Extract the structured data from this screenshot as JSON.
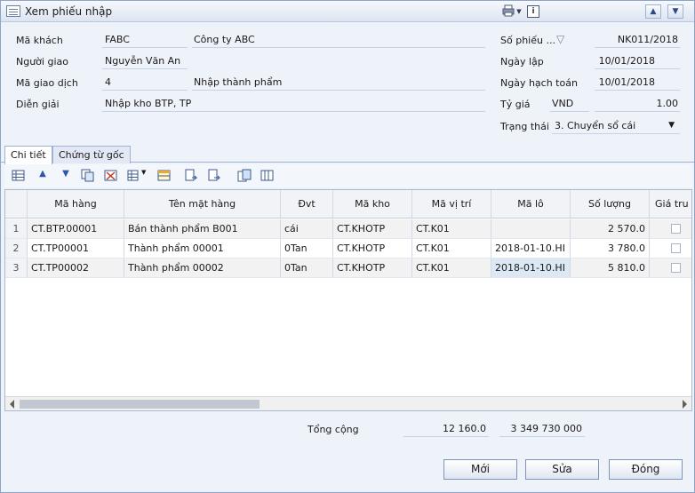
{
  "window": {
    "title": "Xem phiếu nhập"
  },
  "header": {
    "ma_khach_label": "Mã khách",
    "ma_khach": "FABC",
    "ten_khach": "Công ty ABC",
    "nguoi_giao_label": "Người giao",
    "nguoi_giao": "Nguyễn Văn An",
    "ma_gd_label": "Mã giao dịch",
    "ma_gd": "4",
    "ten_gd": "Nhập thành phẩm",
    "dien_giai_label": "Diễn giải",
    "dien_giai": "Nhập kho BTP, TP",
    "so_phieu_label": "Số phiếu ...",
    "so_phieu": "NK011/2018",
    "ngay_lap_label": "Ngày lập",
    "ngay_lap": "10/01/2018",
    "ngay_ht_label": "Ngày hạch toán",
    "ngay_ht": "10/01/2018",
    "ty_gia_label": "Tỷ giá",
    "currency": "VND",
    "ty_gia": "1.00",
    "trang_thai_label": "Trạng thái",
    "trang_thai": "3. Chuyển sổ cái"
  },
  "tabs": [
    "Chi tiết",
    "Chứng từ gốc"
  ],
  "grid": {
    "columns": [
      "Mã hàng",
      "Tên mặt hàng",
      "Đvt",
      "Mã kho",
      "Mã vị trí",
      "Mã lô",
      "Số lượng",
      "Giá tru"
    ],
    "rows": [
      {
        "n": "1",
        "ma": "CT.BTP.00001",
        "ten": "Bán thành phẩm B001",
        "dvt": "cái",
        "kho": "CT.KHOTP",
        "vitri": "CT.K01",
        "lo": "",
        "sl": "2 570.0"
      },
      {
        "n": "2",
        "ma": "CT.TP00001",
        "ten": "Thành phẩm 00001",
        "dvt": "0Tan",
        "kho": "CT.KHOTP",
        "vitri": "CT.K01",
        "lo": "2018-01-10.HI",
        "sl": "3 780.0"
      },
      {
        "n": "3",
        "ma": "CT.TP00002",
        "ten": "Thành phẩm 00002",
        "dvt": "0Tan",
        "kho": "CT.KHOTP",
        "vitri": "CT.K01",
        "lo": "2018-01-10.HI",
        "sl": "5 810.0"
      }
    ]
  },
  "footer": {
    "tong_label": "Tổng cộng",
    "tong_sl": "12 160.0",
    "tong_tien": "3 349 730 000"
  },
  "buttons": {
    "moi": "Mới",
    "sua": "Sửa",
    "dong": "Đóng"
  },
  "icons": {
    "dropdown": "▼",
    "arrow_up": "▲",
    "arrow_down": "▼",
    "nav_up": "▲",
    "nav_down": "▼",
    "funnel": "▽",
    "tb_info": "i",
    "scroll_left": "◀",
    "scroll_right": "▶"
  }
}
